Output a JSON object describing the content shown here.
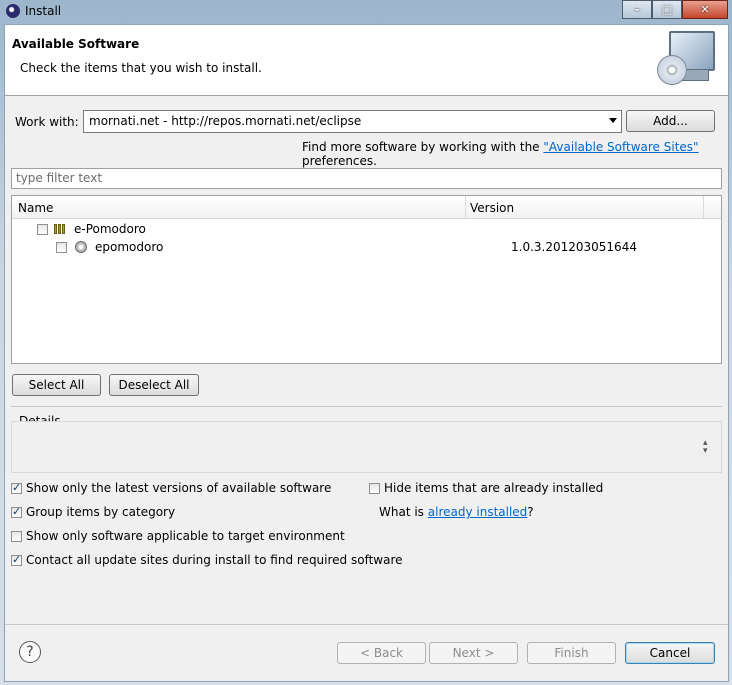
{
  "window": {
    "title": "Install",
    "caption": {
      "minimize": "–",
      "maximize": "□",
      "close": "✕"
    }
  },
  "header": {
    "title": "Available Software",
    "subtitle": "Check the items that you wish to install."
  },
  "work_with": {
    "label": "Work with:",
    "value": "mornati.net - http://repos.mornati.net/eclipse",
    "add_button": "Add...",
    "find_more_prefix": "Find more software by working with the ",
    "find_more_link": "\"Available Software Sites\"",
    "find_more_suffix": " preferences."
  },
  "filter": {
    "placeholder": "type filter text"
  },
  "tree": {
    "columns": [
      "Name",
      "Version"
    ],
    "rows": [
      {
        "name": "e-Pomodoro",
        "version": "",
        "checked": false,
        "type": "category",
        "icon": "category-icon"
      },
      {
        "name": "epomodoro",
        "version": "1.0.3.201203051644",
        "checked": false,
        "type": "feature",
        "icon": "feature-icon"
      }
    ]
  },
  "buttons": {
    "select_all": "Select All",
    "deselect_all": "Deselect All",
    "back": "< Back",
    "next": "Next >",
    "finish": "Finish",
    "cancel": "Cancel"
  },
  "details": {
    "label": "Details"
  },
  "options": {
    "latest_versions": {
      "label": "Show only the latest versions of available software",
      "checked": true
    },
    "group_by_category": {
      "label": "Group items by category",
      "checked": true
    },
    "applicable_only": {
      "label": "Show only software applicable to target environment",
      "checked": false
    },
    "contact_sites": {
      "label": "Contact all update sites during install to find required software",
      "checked": true
    },
    "hide_installed": {
      "label": "Hide items that are already installed",
      "checked": false
    },
    "what_is_prefix": "What is ",
    "what_is_link": "already installed",
    "what_is_suffix": "?"
  },
  "help": {
    "glyph": "?"
  }
}
